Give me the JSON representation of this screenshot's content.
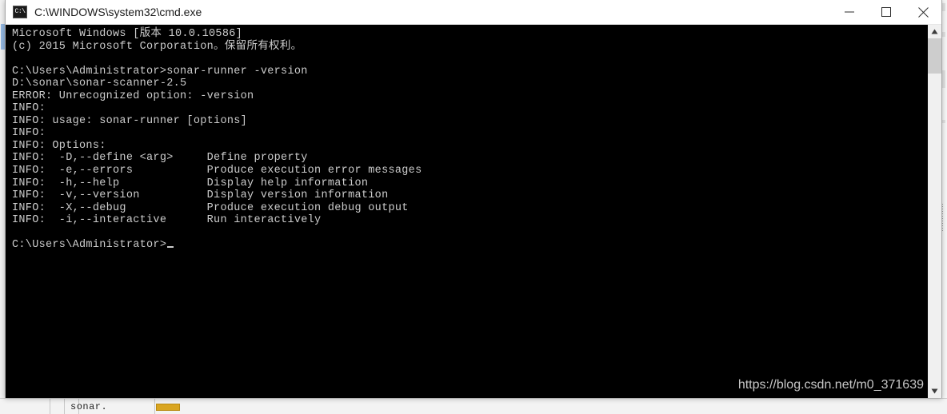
{
  "window": {
    "title": "C:\\WINDOWS\\system32\\cmd.exe",
    "icon": "cmd-icon",
    "icon_label": "C:\\",
    "controls": {
      "minimize": "minimize-button",
      "maximize": "maximize-button",
      "close": "close-button"
    }
  },
  "console": {
    "background_color": "#000000",
    "text_color": "#cccccc",
    "lines": [
      "Microsoft Windows [版本 10.0.10586]",
      "(c) 2015 Microsoft Corporation。保留所有权利。",
      "",
      "C:\\Users\\Administrator>sonar-runner -version",
      "D:\\sonar\\sonar-scanner-2.5",
      "ERROR: Unrecognized option: -version",
      "INFO:",
      "INFO: usage: sonar-runner [options]",
      "INFO:",
      "INFO: Options:",
      "INFO:  -D,--define <arg>     Define property",
      "INFO:  -e,--errors           Produce execution error messages",
      "INFO:  -h,--help             Display help information",
      "INFO:  -v,--version          Display version information",
      "INFO:  -X,--debug            Produce execution debug output",
      "INFO:  -i,--interactive      Run interactively",
      "",
      "C:\\Users\\Administrator>"
    ],
    "prompt": "C:\\Users\\Administrator>"
  },
  "scrollbar": {
    "up_arrow": "scroll-up-icon",
    "down_arrow": "scroll-down-icon"
  },
  "watermark": {
    "text": "https://blog.csdn.net/m0_371639"
  },
  "background": {
    "editor_text": "sonar."
  }
}
